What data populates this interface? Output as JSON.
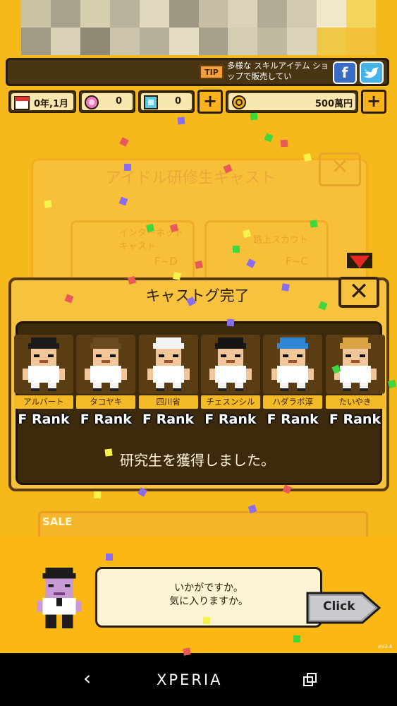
{
  "tip": {
    "badge": "TIP",
    "message": "多様な スキルアイテム ショップで販売してい"
  },
  "social": {
    "facebook": "f"
  },
  "resources": {
    "date": "0年,1月",
    "gems_pink": "0",
    "gems_blue": "0",
    "money": "500萬円"
  },
  "background_panel": {
    "title": "アイドル研修生キャスト",
    "card1_label": "インターネット キャスト",
    "card1_rank": "F~D",
    "card2_label": "路上スカウト",
    "card2_rank": "F~C",
    "sale": "SALE"
  },
  "dialog": {
    "title": "キャストグ完了",
    "message": "研究生を獲得しました。",
    "trainees": [
      {
        "name": "アルバート",
        "rank": "F Rank",
        "hair": "#1c1c1c",
        "skin": "#f0c69a"
      },
      {
        "name": "タコヤキ",
        "rank": "F Rank",
        "hair": "#6b4a20",
        "skin": "#f0c69a"
      },
      {
        "name": "四川省",
        "rank": "F Rank",
        "hair": "#f3f3f3",
        "skin": "#f0c69a"
      },
      {
        "name": "チェスンシル",
        "rank": "F Rank",
        "hair": "#151515",
        "skin": "#f0c69a"
      },
      {
        "name": "ハダラボ淳",
        "rank": "F Rank",
        "hair": "#2f86d6",
        "skin": "#f0c69a"
      },
      {
        "name": "たいやき",
        "rank": "F Rank",
        "hair": "#d9a441",
        "skin": "#f0c69a"
      }
    ]
  },
  "npc": {
    "speech_line1": "いかがですか。",
    "speech_line2": "気に入りますか。",
    "click_label": "Click"
  },
  "version": "aV2.4",
  "navbar": {
    "brand": "XPERIA"
  },
  "colors": {
    "background": "#f6b91c",
    "dark_brown": "#3d2a0d",
    "panel_yellow": "#f7c33e"
  }
}
